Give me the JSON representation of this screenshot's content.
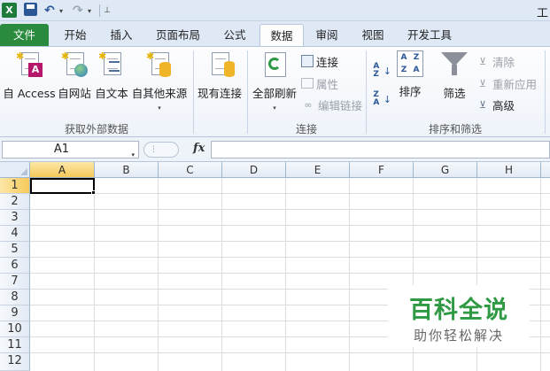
{
  "app": {
    "title": "工"
  },
  "quick_access": {
    "logo_label": "X",
    "undo_glyph": "↶",
    "redo_glyph": "↷",
    "dropdown_glyph": "▾",
    "customize_glyph": "⊥"
  },
  "tabs": [
    {
      "label": "文件"
    },
    {
      "label": "开始"
    },
    {
      "label": "插入"
    },
    {
      "label": "页面布局"
    },
    {
      "label": "公式"
    },
    {
      "label": "数据"
    },
    {
      "label": "审阅"
    },
    {
      "label": "视图"
    },
    {
      "label": "开发工具"
    }
  ],
  "active_tab": "数据",
  "ribbon": {
    "groups": {
      "external": {
        "label": "获取外部数据",
        "buttons": [
          {
            "label": "自 Access",
            "icon": "access-db-icon"
          },
          {
            "label": "自网站",
            "icon": "web-globe-icon"
          },
          {
            "label": "自文本",
            "icon": "text-file-icon"
          },
          {
            "label": "自其他来源",
            "icon": "other-sources-icon"
          }
        ]
      },
      "existing": {
        "label": "现有连接",
        "icon": "existing-connections-icon"
      },
      "connections": {
        "label": "连接",
        "refresh_label": "全部刷新",
        "items": [
          {
            "label": "连接",
            "enabled": true
          },
          {
            "label": "属性",
            "enabled": false
          },
          {
            "label": "编辑链接",
            "enabled": false
          }
        ]
      },
      "sort_filter": {
        "label": "排序和筛选",
        "sort_label": "排序",
        "filter_label": "筛选",
        "items": [
          {
            "label": "清除",
            "enabled": false
          },
          {
            "label": "重新应用",
            "enabled": false
          },
          {
            "label": "高级",
            "enabled": true
          }
        ]
      }
    },
    "dropdown_glyph": "▾"
  },
  "formula_bar": {
    "name_box": "A1",
    "fx_label": "fx",
    "formula": ""
  },
  "grid": {
    "columns": [
      "A",
      "B",
      "C",
      "D",
      "E",
      "F",
      "G",
      "H"
    ],
    "rows": [
      "1",
      "2",
      "3",
      "4",
      "5",
      "6",
      "7",
      "8",
      "9",
      "10",
      "11",
      "12"
    ],
    "selected_cell": "A1"
  },
  "watermark": {
    "title": "百科全说",
    "subtitle": "助你轻松解决"
  },
  "colors": {
    "file_tab": "#2a8a3e",
    "ribbon_bg": "#dfe8f5",
    "selection_header": "#f6c95a",
    "watermark_green": "#2f9a43"
  }
}
